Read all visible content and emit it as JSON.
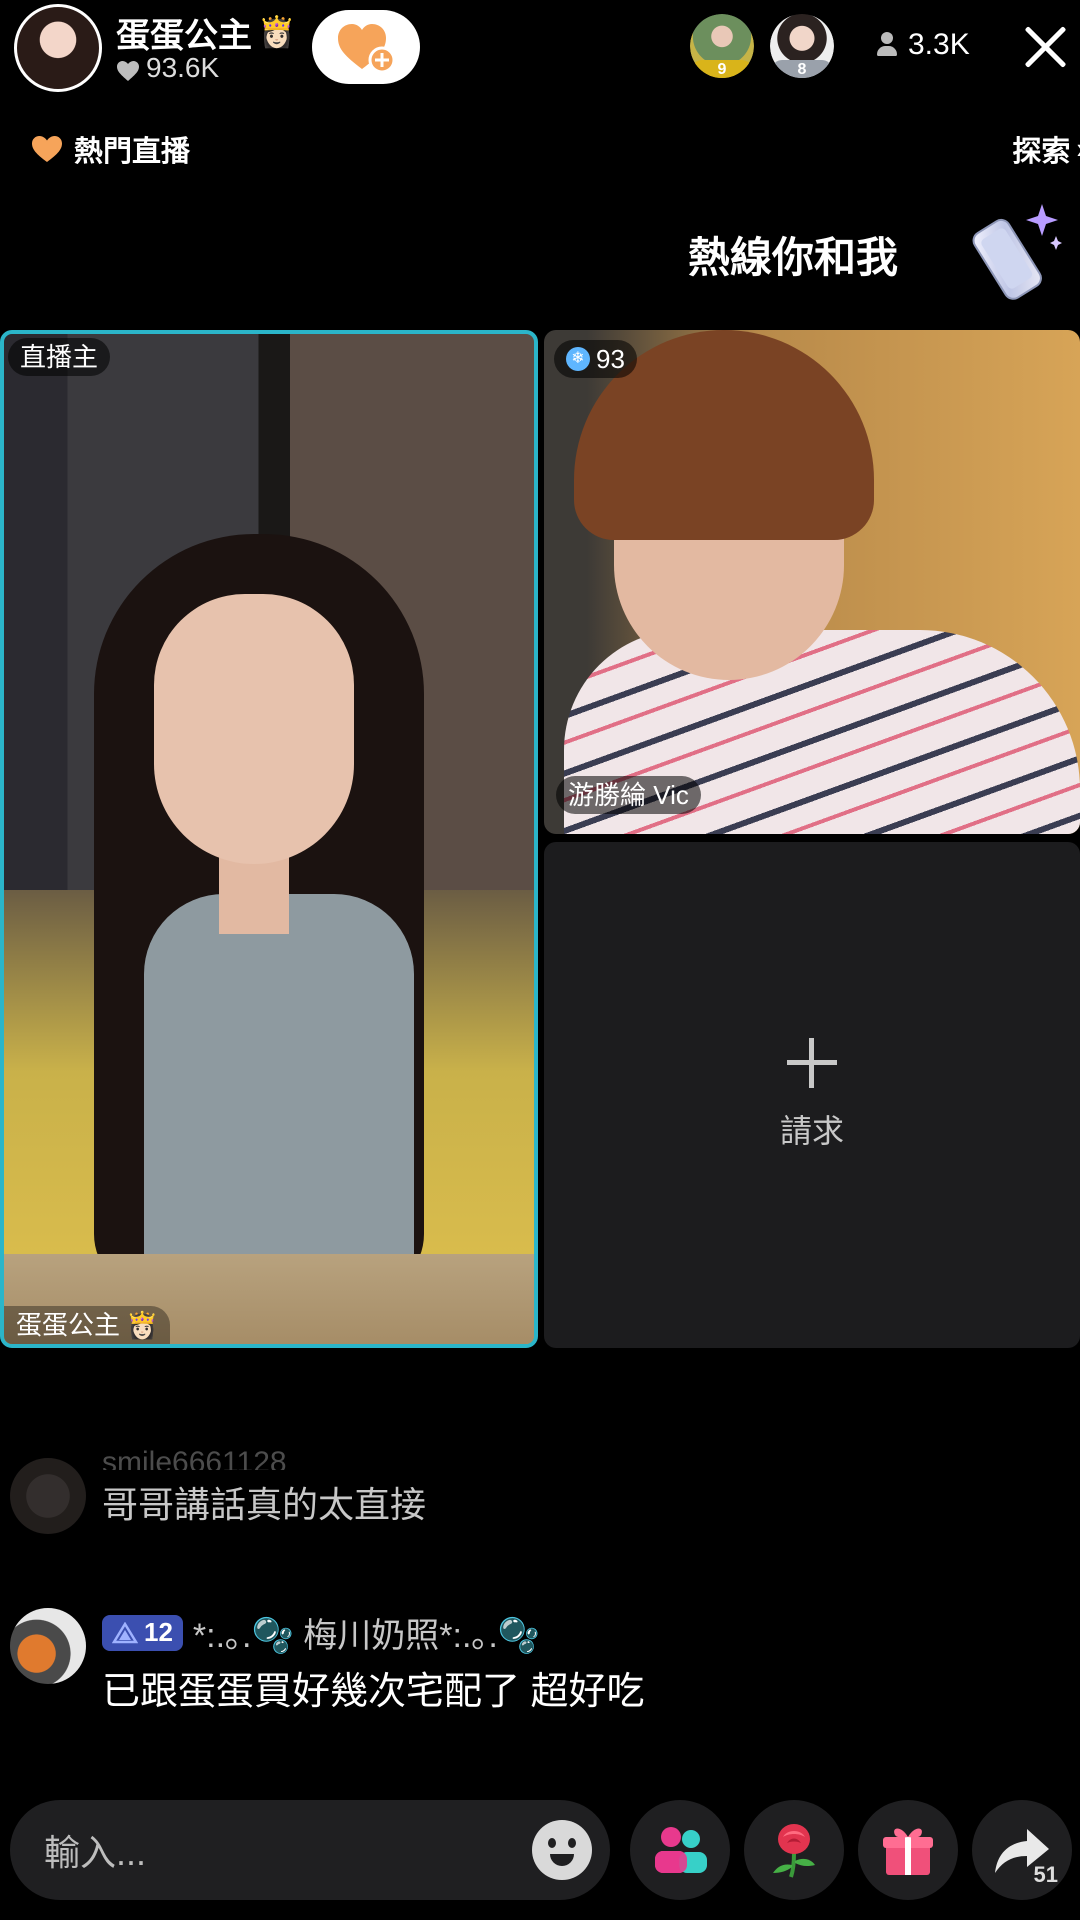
{
  "header": {
    "host_name": "蛋蛋公主",
    "host_crown": "👸🏻",
    "host_likes": "93.6K",
    "viewers": [
      {
        "rank": "9",
        "color": "#d9b41a"
      },
      {
        "rank": "8",
        "color": "#9aa1ab"
      }
    ],
    "viewer_count": "3.3K"
  },
  "subheader": {
    "hot_live_label": "熱門直播",
    "explore_label": "探索",
    "explore_chevron": "›"
  },
  "hotline": {
    "title": "熱線你和我"
  },
  "tiles": {
    "host": {
      "role_tag": "直播主",
      "name": "蛋蛋公主",
      "crown": "👸🏻",
      "border_color": "#2bb5c9"
    },
    "guest": {
      "level": "93",
      "name": "游勝綸 Vic"
    },
    "request": {
      "label": "請求"
    }
  },
  "comments": [
    {
      "user": "smile6661128",
      "text": "哥哥講話真的太直接"
    },
    {
      "level": "12",
      "user": "*:.｡.🫧 梅川奶照*:.｡.🫧",
      "text": "已跟蛋蛋買好幾次宅配了 超好吃"
    }
  ],
  "bottom_bar": {
    "input_placeholder": "輸入...",
    "share_count": "51"
  },
  "colors": {
    "accent_cyan": "#2bb5c9",
    "heart_orange": "#f6a45a",
    "level_badge": "#3b4fb0",
    "guests_icon": "#e8398d",
    "gift_icon": "#f0507a"
  }
}
